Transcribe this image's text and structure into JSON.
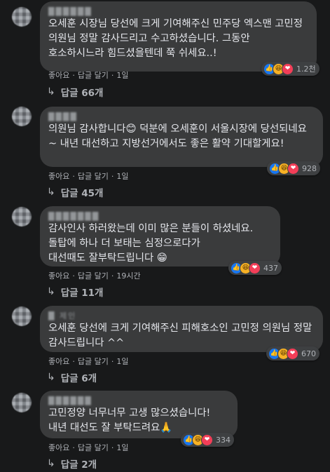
{
  "comments": [
    {
      "name": "██████",
      "text": "오세훈 시장님 당선에 크게 기여해주신 민주당 엑스맨 고민정 의원님 정말 감사드리고 수고하셨습니다. 그동안 호소하시느라 힘드셨을텐데 쭉 쉬세요..!",
      "reactions": [
        "like",
        "haha",
        "love"
      ],
      "reaction_count": "1.2천",
      "like_label": "좋아요",
      "reply_label": "답글 달기",
      "time": "1일",
      "replies_label": "답글 66개"
    },
    {
      "name": "████",
      "text": "의원님 감사합니다😊 덕분에 오세훈이 서울시장에 당선되네요~ 내년 대선하고 지방선거에서도 좋은 활약 기대할게요!",
      "reactions": [
        "like",
        "haha",
        "love"
      ],
      "reaction_count": "928",
      "like_label": "좋아요",
      "reply_label": "답글 달기",
      "time": "1일",
      "replies_label": "답글 45개"
    },
    {
      "name": "███████",
      "text": "감사인사 하러왔는데 이미 많은 분들이 하셨네요.\n돌탑에 하나 더 보태는 심정으로다가\n대선때도 잘부탁드립니다 😁",
      "reactions": [
        "like",
        "haha",
        "love"
      ],
      "reaction_count": "437",
      "like_label": "좋아요",
      "reply_label": "답글 달기",
      "time": "19시간",
      "replies_label": "답글 11개"
    },
    {
      "name": "█ 제인",
      "text": "오세훈 당선에 크게 기여해주신 피해호소인 고민정 의원님 정말 감사드립니다 ^^",
      "reactions": [
        "like",
        "haha",
        "love"
      ],
      "reaction_count": "670",
      "like_label": "좋아요",
      "reply_label": "답글 달기",
      "time": "1일",
      "replies_label": "답글 6개"
    },
    {
      "name": "██████",
      "text": "고민정양 너무너무 고생 많으셨습니다!\n내년 대선도 잘 부탁드려요🙏",
      "reactions": [
        "like",
        "haha",
        "love"
      ],
      "reaction_count": "334",
      "like_label": "좋아요",
      "reply_label": "답글 달기",
      "time": "1일",
      "replies_label": "답글 2개"
    }
  ],
  "icons": {
    "like": "👍",
    "haha": "😆",
    "love": "❤",
    "reply_arrow": "↳"
  },
  "colors": {
    "background": "#18191a",
    "bubble": "#3a3b3c",
    "text": "#e4e6eb",
    "secondary": "#b0b3b8",
    "like": "#1877f2",
    "haha": "#f7b125",
    "love": "#f33e58"
  }
}
